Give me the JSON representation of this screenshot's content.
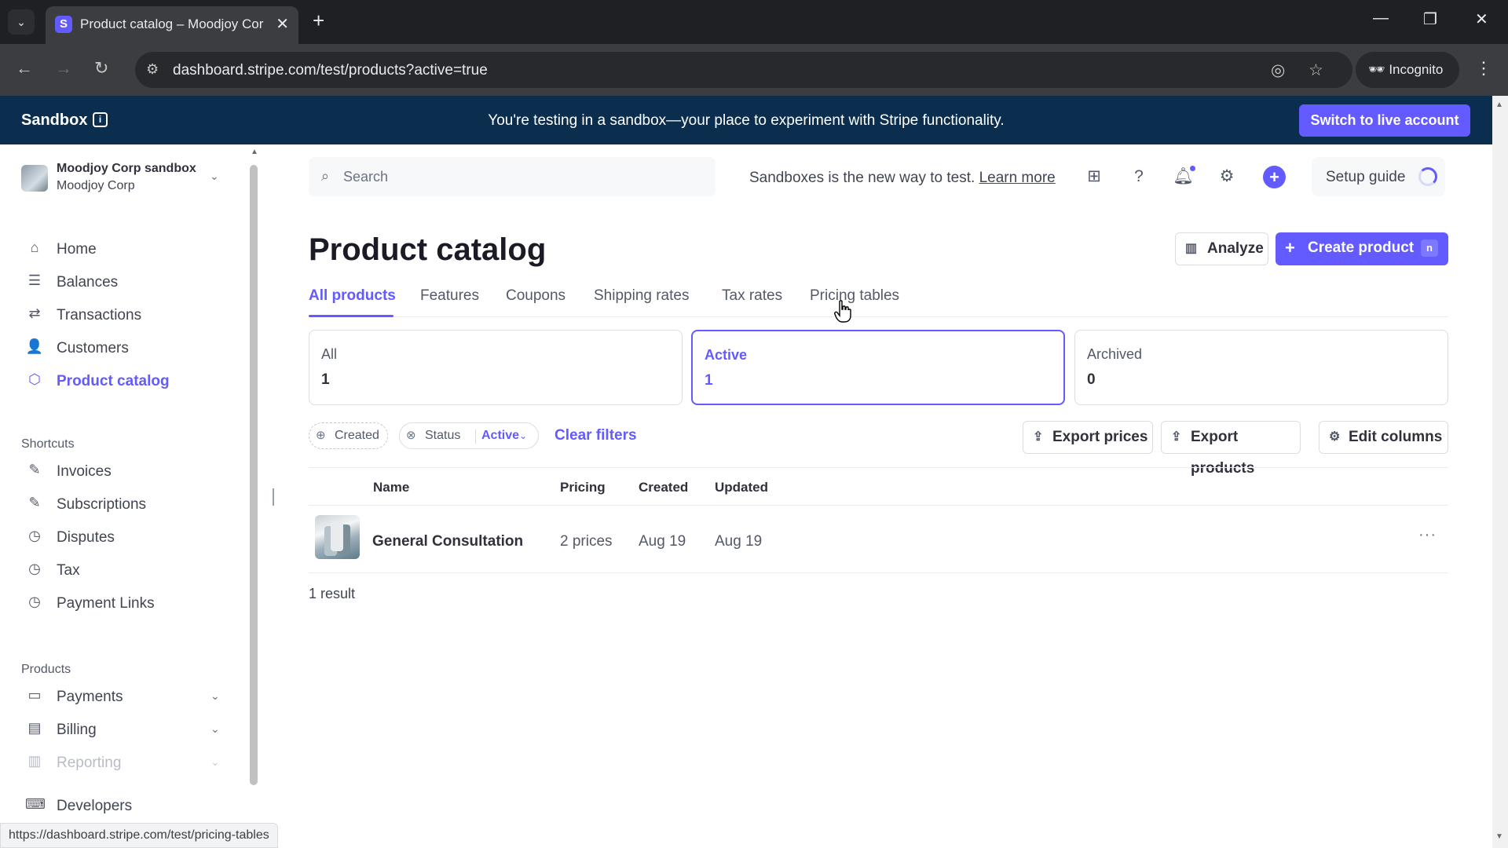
{
  "browser": {
    "tab_title": "Product catalog – Moodjoy Cor",
    "url": "dashboard.stripe.com/test/products?active=true",
    "incognito_label": "Incognito",
    "status_url": "https://dashboard.stripe.com/test/pricing-tables"
  },
  "banner": {
    "label": "Sandbox",
    "message": "You're testing in a sandbox—your place to experiment with Stripe functionality.",
    "switch_label": "Switch to live account"
  },
  "account": {
    "name": "Moodjoy Corp sandbox",
    "org": "Moodjoy Corp"
  },
  "sidebar": {
    "main": [
      {
        "label": "Home",
        "icon": "home-icon"
      },
      {
        "label": "Balances",
        "icon": "balances-icon"
      },
      {
        "label": "Transactions",
        "icon": "transactions-icon"
      },
      {
        "label": "Customers",
        "icon": "customers-icon"
      },
      {
        "label": "Product catalog",
        "icon": "product-catalog-icon"
      }
    ],
    "shortcuts_heading": "Shortcuts",
    "shortcuts": [
      {
        "label": "Invoices",
        "icon": "pin-icon"
      },
      {
        "label": "Subscriptions",
        "icon": "pin-icon"
      },
      {
        "label": "Disputes",
        "icon": "clock-icon"
      },
      {
        "label": "Tax",
        "icon": "clock-icon"
      },
      {
        "label": "Payment Links",
        "icon": "clock-icon"
      }
    ],
    "products_heading": "Products",
    "products": [
      {
        "label": "Payments",
        "icon": "payments-icon"
      },
      {
        "label": "Billing",
        "icon": "billing-icon"
      },
      {
        "label": "Reporting",
        "icon": "reporting-icon"
      }
    ],
    "developers": "Developers"
  },
  "header": {
    "search_placeholder": "Search",
    "promo_text": "Sandboxes is the new way to test.",
    "promo_link": "Learn more",
    "setup_guide": "Setup guide"
  },
  "main": {
    "title": "Product catalog",
    "analyze_label": "Analyze",
    "create_label": "Create product",
    "create_shortcut": "n",
    "tabs": [
      "All products",
      "Features",
      "Coupons",
      "Shipping rates",
      "Tax rates",
      "Pricing tables"
    ],
    "counts": [
      {
        "label": "All",
        "value": "1"
      },
      {
        "label": "Active",
        "value": "1"
      },
      {
        "label": "Archived",
        "value": "0"
      }
    ],
    "filters": {
      "created": "Created",
      "status": "Status",
      "status_value": "Active",
      "clear": "Clear filters"
    },
    "actions": {
      "export_prices": "Export prices",
      "export_products": "Export products",
      "edit_columns": "Edit columns"
    },
    "table": {
      "columns": [
        "Name",
        "Pricing",
        "Created",
        "Updated"
      ],
      "rows": [
        {
          "name": "General Consultation",
          "pricing": "2 prices",
          "created": "Aug 19",
          "updated": "Aug 19"
        }
      ]
    },
    "result_count": "1 result"
  },
  "colors": {
    "accent": "#635bff",
    "banner": "#0b2e4f"
  }
}
